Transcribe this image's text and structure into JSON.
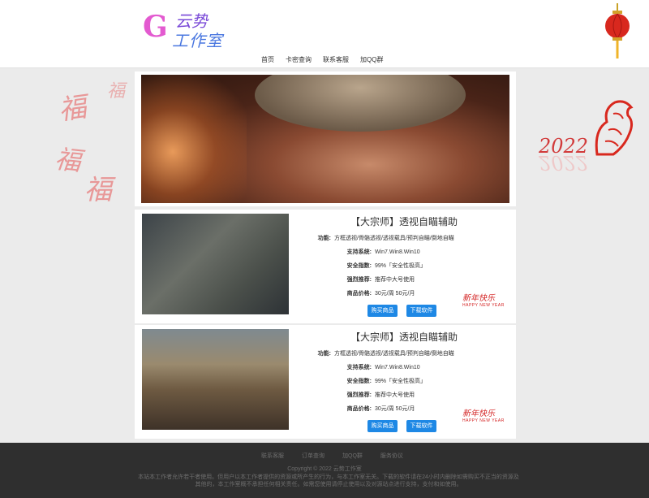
{
  "brand": {
    "mark": "G",
    "line1": "云势",
    "line2": "工作室"
  },
  "nav": [
    "首页",
    "卡密查询",
    "联系客服",
    "加QQ群"
  ],
  "decor": {
    "year": "2022",
    "fu": "福"
  },
  "products": [
    {
      "title": "【大宗师】透视自瞄辅助",
      "features_label": "功能:",
      "features": "方框透视/骨骼透视/透视载具/预判自瞄/倒地自瞄",
      "system_label": "支持系统:",
      "system": "Win7.Win8.Win10",
      "safety_label": "安全指数:",
      "safety": "99%「安全性极高」",
      "recommend_label": "强烈推荐:",
      "recommend": "推荐中大号使用",
      "price_label": "商品价格:",
      "price": "30元/周 50元/月",
      "buy": "购买商品",
      "download": "下载软件"
    },
    {
      "title": "【大宗师】透视自瞄辅助",
      "features_label": "功能:",
      "features": "方框透视/骨骼透视/透视载具/预判自瞄/倒地自瞄",
      "system_label": "支持系统:",
      "system": "Win7.Win8.Win10",
      "safety_label": "安全指数:",
      "safety": "99%「安全性极高」",
      "recommend_label": "强烈推荐:",
      "recommend": "推荐中大号使用",
      "price_label": "商品价格:",
      "price": "30元/周 50元/月",
      "buy": "购买商品",
      "download": "下载软件"
    }
  ],
  "new_year": {
    "cn": "新年快乐",
    "en": "HAPPY NEW YEAR"
  },
  "footer": {
    "links": [
      "联系客服",
      "订单查询",
      "加QQ群",
      "服务协议"
    ],
    "copyright": "Copyright © 2022 云势工作室",
    "disclaimer": "本站本工作者允许若干者使用。但用户以本工作者提供的资源或所产生的行为，与本工作室无关。下载的软件请在24小时内删除如需购买不正当的资源及其他的，本工作室概不承担任何相关责任。如需您使用请停止使用以及对源站点进行支持，支付和如使用。"
  }
}
